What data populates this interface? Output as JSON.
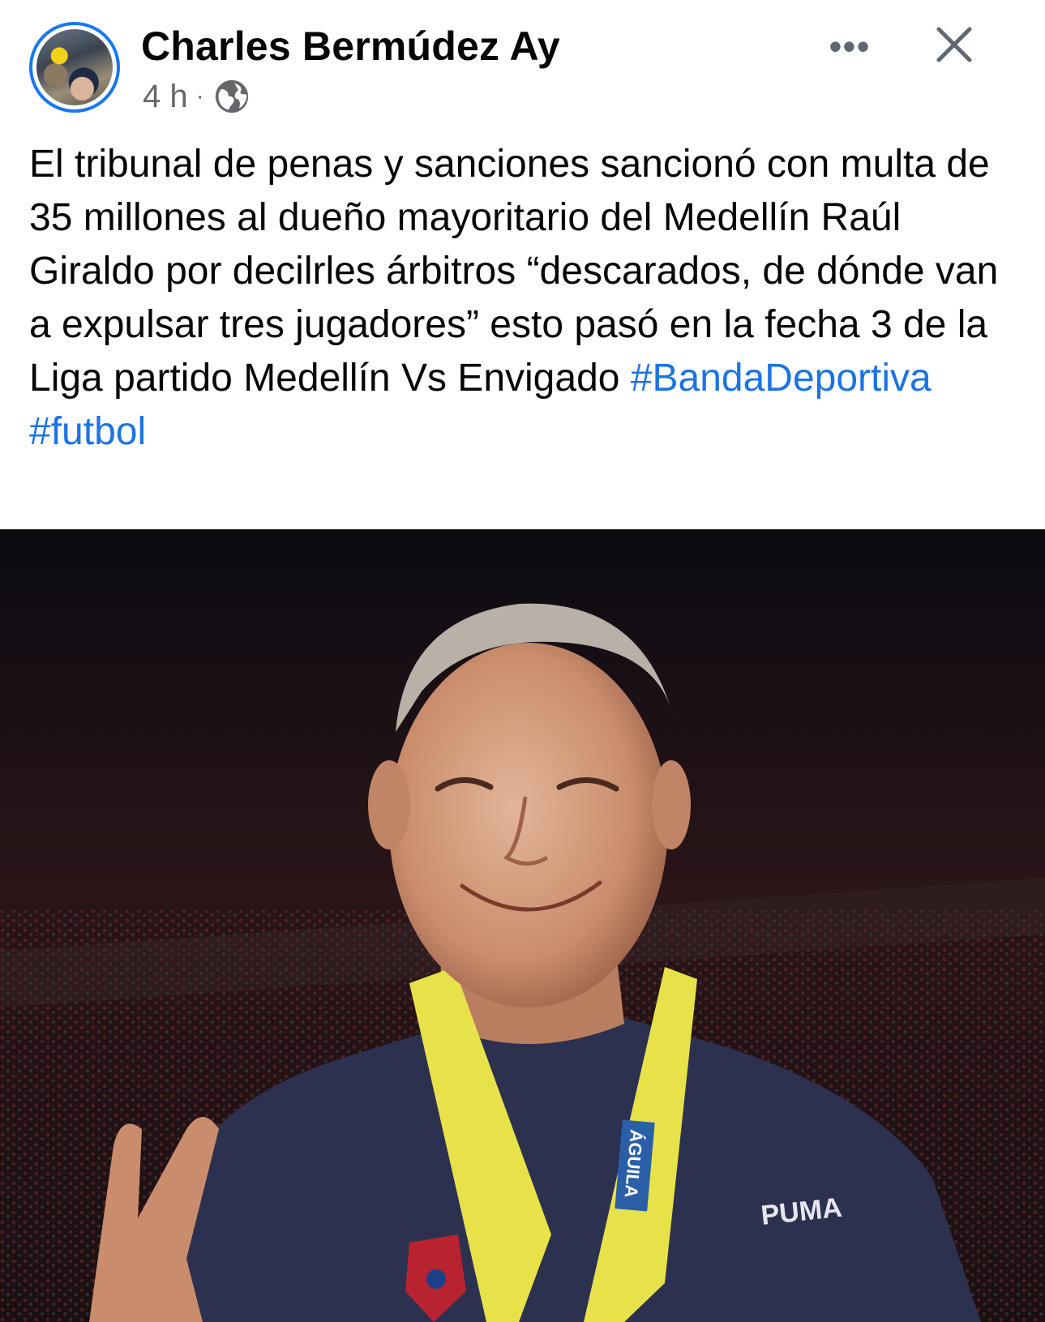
{
  "post": {
    "author": "Charles Bermúdez Ay",
    "timestamp": "4 h",
    "separator": "·",
    "privacy_icon": "globe-icon",
    "more_label": "•••",
    "text_plain": "El tribunal de penas y sanciones sancionó con multa de 35 millones al dueño mayoritario del Medellín  Raúl Giraldo por decilrles árbitros “descarados, de dónde van a expulsar tres jugadores” esto pasó en  la fecha 3 de la Liga partido Medellín Vs Envigado ",
    "hashtags": [
      "#BandaDeportiva",
      "#futbol"
    ],
    "photo": {
      "kit_brand": "PUMA",
      "medal_ribbon_text": "ÁGUILA"
    }
  },
  "colors": {
    "hashtag": "#1b74e4",
    "avatar_ring": "#1877f2",
    "meta_text": "#65676b",
    "photo_background": "#0b0b12",
    "medal_ribbon": "#e8e24a",
    "jersey": "#2d3150"
  }
}
